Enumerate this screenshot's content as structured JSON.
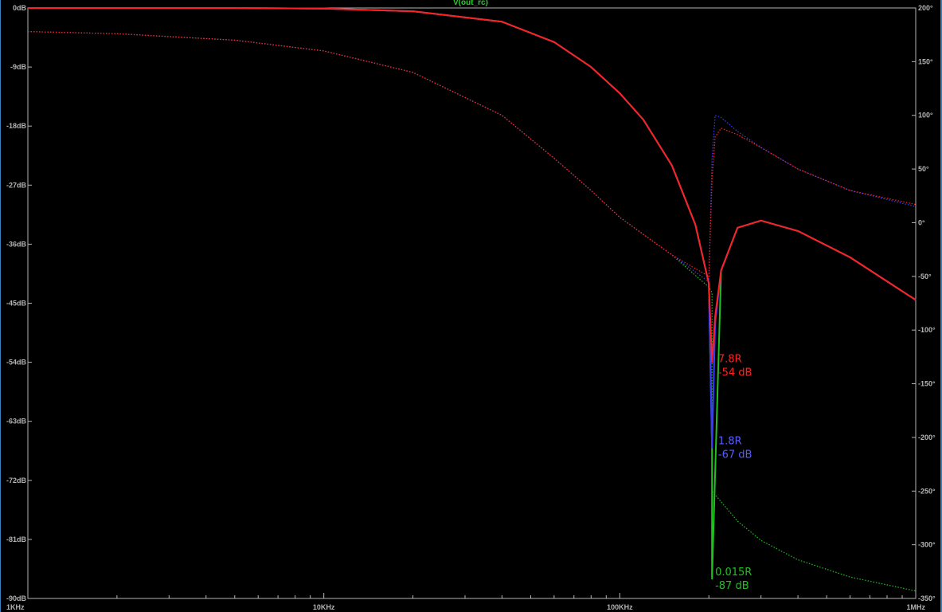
{
  "chart_data": {
    "type": "line",
    "title": "V(out_rc)",
    "x_scale": "log",
    "xlim": [
      1000,
      1000000
    ],
    "x_ticks": [
      {
        "value": 1000,
        "label": "1KHz"
      },
      {
        "value": 10000,
        "label": "10KHz"
      },
      {
        "value": 100000,
        "label": "100KHz"
      },
      {
        "value": 1000000,
        "label": "1MHz"
      }
    ],
    "ylim_left": [
      -90,
      0
    ],
    "y_left_ticks": [
      {
        "value": 0,
        "label": "0dB"
      },
      {
        "value": -9,
        "label": "-9dB"
      },
      {
        "value": -18,
        "label": "-18dB"
      },
      {
        "value": -27,
        "label": "-27dB"
      },
      {
        "value": -36,
        "label": "-36dB"
      },
      {
        "value": -45,
        "label": "-45dB"
      },
      {
        "value": -54,
        "label": "-54dB"
      },
      {
        "value": -63,
        "label": "-63dB"
      },
      {
        "value": -72,
        "label": "-72dB"
      },
      {
        "value": -81,
        "label": "-81dB"
      },
      {
        "value": -90,
        "label": "-90dB"
      }
    ],
    "ylim_right": [
      -350,
      200
    ],
    "y_right_ticks": [
      {
        "value": 200,
        "label": "200°"
      },
      {
        "value": 150,
        "label": "150°"
      },
      {
        "value": 100,
        "label": "100°"
      },
      {
        "value": 50,
        "label": "50°"
      },
      {
        "value": 0,
        "label": "0°"
      },
      {
        "value": -50,
        "label": "-50°"
      },
      {
        "value": -100,
        "label": "-100°"
      },
      {
        "value": -150,
        "label": "-150°"
      },
      {
        "value": -200,
        "label": "-200°"
      },
      {
        "value": -250,
        "label": "-250°"
      },
      {
        "value": -300,
        "label": "-300°"
      },
      {
        "value": -350,
        "label": "-350°"
      }
    ],
    "grid": false,
    "series": [
      {
        "color": "#22c022",
        "kind": "magnitude",
        "axis": "left",
        "x": [
          1000,
          2000,
          5000,
          10000,
          20000,
          40000,
          60000,
          80000,
          100000,
          120000,
          150000,
          180000,
          200000,
          205000,
          205000,
          220000,
          250000,
          300000,
          400000,
          600000,
          1000000
        ],
        "y": [
          0,
          0,
          0,
          -0.1,
          -0.5,
          -2.1,
          -5.2,
          -9.0,
          -13.0,
          -17.0,
          -24.0,
          -33.0,
          -42.0,
          -67.0,
          -87.0,
          -40.0,
          -33.5,
          -32.4,
          -34.0,
          -38.0,
          -44.5
        ]
      },
      {
        "color": "#22c022",
        "kind": "phase",
        "axis": "right",
        "x": [
          1000,
          2000,
          5000,
          10000,
          20000,
          40000,
          60000,
          80000,
          100000,
          150000,
          200000,
          205000,
          205000,
          250000,
          300000,
          400000,
          600000,
          1000000
        ],
        "y": [
          178,
          176,
          170,
          160,
          140,
          100,
          60,
          30,
          5,
          -30,
          -60,
          -65,
          -250,
          -278,
          -296,
          -314,
          -330,
          -343
        ]
      },
      {
        "color": "#3a3aff",
        "kind": "magnitude",
        "axis": "left",
        "x": [
          1000,
          2000,
          5000,
          10000,
          20000,
          40000,
          60000,
          80000,
          100000,
          120000,
          150000,
          180000,
          200000,
          205000,
          210000,
          220000,
          250000,
          300000,
          400000,
          600000,
          1000000
        ],
        "y": [
          0,
          0,
          0,
          -0.1,
          -0.5,
          -2.1,
          -5.2,
          -9.0,
          -13.0,
          -17.0,
          -24.0,
          -33.0,
          -42.0,
          -67.0,
          -48.0,
          -40.0,
          -33.5,
          -32.4,
          -34.0,
          -38.0,
          -44.5
        ]
      },
      {
        "color": "#3a3aff",
        "kind": "phase",
        "axis": "right",
        "x": [
          1000,
          2000,
          5000,
          10000,
          20000,
          40000,
          60000,
          80000,
          100000,
          150000,
          200000,
          205000,
          210000,
          220000,
          250000,
          300000,
          400000,
          600000,
          1000000
        ],
        "y": [
          178,
          176,
          170,
          160,
          140,
          100,
          60,
          30,
          5,
          -30,
          -55,
          60,
          100,
          98,
          85,
          70,
          50,
          30,
          15
        ]
      },
      {
        "color": "#ff2020",
        "kind": "magnitude",
        "axis": "left",
        "x": [
          1000,
          2000,
          5000,
          10000,
          20000,
          40000,
          60000,
          80000,
          100000,
          120000,
          150000,
          180000,
          200000,
          205000,
          210000,
          220000,
          250000,
          300000,
          400000,
          600000,
          1000000
        ],
        "y": [
          0,
          0,
          0,
          -0.1,
          -0.5,
          -2.1,
          -5.2,
          -9.0,
          -13.0,
          -17.0,
          -24.0,
          -33.0,
          -42.0,
          -54.0,
          -47.0,
          -40.0,
          -33.5,
          -32.4,
          -34.0,
          -38.0,
          -44.5
        ]
      },
      {
        "color": "#ff2020",
        "kind": "phase",
        "axis": "right",
        "x": [
          1000,
          2000,
          5000,
          10000,
          20000,
          40000,
          60000,
          80000,
          100000,
          150000,
          200000,
          205000,
          210000,
          220000,
          250000,
          300000,
          400000,
          600000,
          1000000
        ],
        "y": [
          178,
          176,
          170,
          160,
          140,
          100,
          60,
          30,
          5,
          -30,
          -50,
          40,
          80,
          88,
          82,
          70,
          50,
          30,
          17
        ]
      }
    ],
    "annotations": [
      {
        "color": "#ff2020",
        "x": 215000,
        "y": -54,
        "lines": [
          "7.8R",
          "-54 dB"
        ]
      },
      {
        "color": "#5a5aff",
        "x": 215000,
        "y": -66.5,
        "lines": [
          "1.8R",
          "-67 dB"
        ]
      },
      {
        "color": "#22c022",
        "x": 210000,
        "y": -86.5,
        "lines": [
          "0.015R",
          "-87 dB"
        ]
      }
    ]
  }
}
